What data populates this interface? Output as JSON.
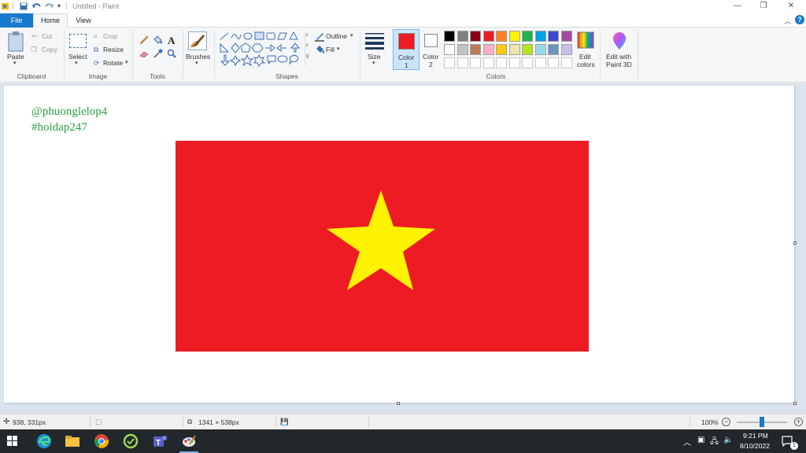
{
  "window": {
    "title": "Untitled - Paint"
  },
  "tabs": [
    {
      "label": "File"
    },
    {
      "label": "Home"
    },
    {
      "label": "View"
    }
  ],
  "ribbon": {
    "clipboard": {
      "paste": "Paste",
      "cut": "Cut",
      "copy": "Copy",
      "group": "Clipboard"
    },
    "image": {
      "select": "Select",
      "crop": "Crop",
      "resize": "Resize",
      "rotate": "Rotate",
      "group": "Image"
    },
    "tools": {
      "group": "Tools"
    },
    "brushes": {
      "label": "Brushes"
    },
    "shapes": {
      "outline": "Outline",
      "fill": "Fill",
      "group": "Shapes"
    },
    "size": {
      "label": "Size"
    },
    "color1": {
      "label": "Color",
      "num": "1",
      "value": "#ed1c24"
    },
    "color2": {
      "label": "Color",
      "num": "2",
      "value": "#ffffff"
    },
    "colors_group": "Colors",
    "edit_colors": {
      "line1": "Edit",
      "line2": "colors"
    },
    "paint3d": {
      "line1": "Edit with",
      "line2": "Paint 3D"
    },
    "palette_row1": [
      "#000000",
      "#7f7f7f",
      "#880015",
      "#ed1c24",
      "#ff7f27",
      "#fff200",
      "#22b14c",
      "#00a2e8",
      "#3f48cc",
      "#a349a4"
    ],
    "palette_row2": [
      "#ffffff",
      "#c3c3c3",
      "#b97a57",
      "#ffaec9",
      "#ffc90e",
      "#efe4b0",
      "#b5e61d",
      "#99d9ea",
      "#7092be",
      "#c8bfe7"
    ]
  },
  "canvas": {
    "watermark_line1": "@phuonglelop4",
    "watermark_line2": "#hoidap247",
    "flag_red": "#ed1c24",
    "star_yellow": "#fff200"
  },
  "status": {
    "cursor_pos": "938, 331px",
    "image_size": "1341 × 538px",
    "zoom": "100%"
  },
  "taskbar": {
    "time": "9:21 PM",
    "date": "8/10/2022",
    "notifications": "1"
  }
}
